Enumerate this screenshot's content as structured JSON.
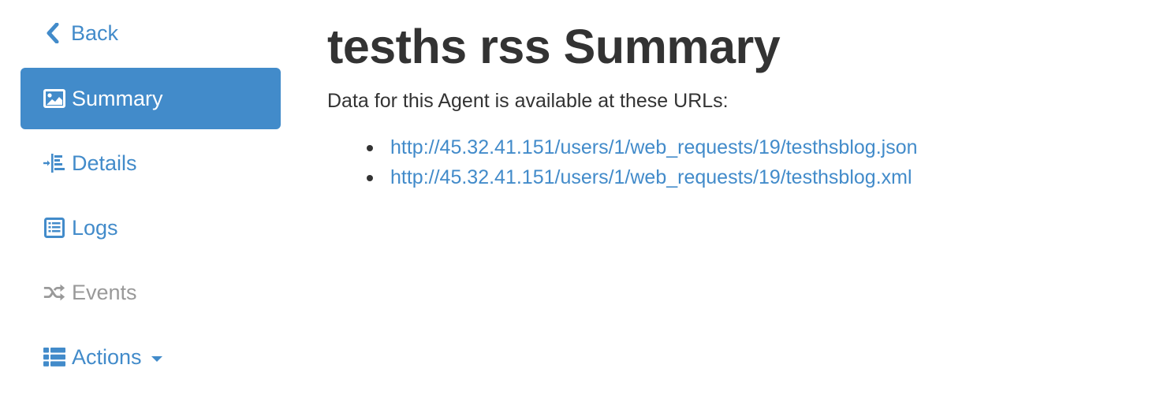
{
  "sidebar": {
    "back_label": "Back",
    "items": [
      {
        "label": "Summary",
        "icon": "image-icon"
      },
      {
        "label": "Details",
        "icon": "indent-icon"
      },
      {
        "label": "Logs",
        "icon": "list-alt-icon"
      },
      {
        "label": "Events",
        "icon": "random-icon"
      },
      {
        "label": "Actions",
        "icon": "th-list-icon"
      }
    ]
  },
  "main": {
    "title": "tesths rss Summary",
    "intro": "Data for this Agent is available at these URLs:",
    "urls": [
      "http://45.32.41.151/users/1/web_requests/19/testhsblog.json",
      "http://45.32.41.151/users/1/web_requests/19/testhsblog.xml"
    ]
  },
  "colors": {
    "accent": "#428bca",
    "active_bg": "#428bca",
    "text": "#333333",
    "muted": "#999999"
  }
}
